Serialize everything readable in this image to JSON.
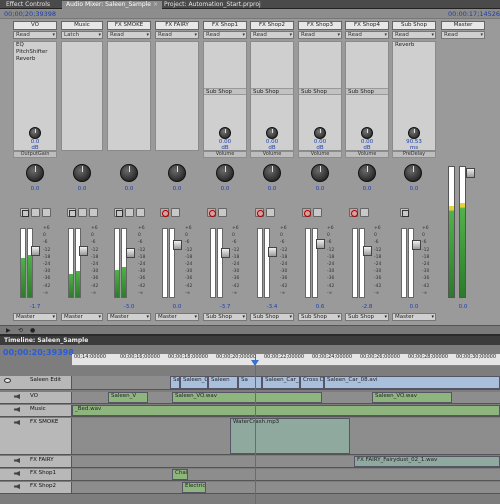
{
  "tabs": [
    {
      "label": "Effect Controls",
      "active": false
    },
    {
      "label": "Audio Mixer: Saleen_Sample",
      "active": true
    },
    {
      "label": "Project: Automation_Start.prproj",
      "active": false
    }
  ],
  "mixer": {
    "timecode_left": "00;00;20;39398",
    "timecode_right": "00:00:17;14526",
    "channels": [
      {
        "name": "VO",
        "mode": "Read",
        "effects": [
          "EQ",
          "PitchShifter",
          "Reverb"
        ],
        "knob_value": "0.0",
        "knob_unit": "dB",
        "param": "OutputGain",
        "pan": "0.0",
        "fader": "-1.7",
        "output": "Master"
      },
      {
        "name": "Music",
        "mode": "Latch",
        "effects": [],
        "pan": "0.0",
        "fader": "",
        "output": "Master"
      },
      {
        "name": "FX SMOKE",
        "mode": "Read",
        "effects": [],
        "pan": "0.0",
        "fader": "-3.0",
        "output": "Master"
      },
      {
        "name": "FX FAIRY",
        "mode": "Read",
        "effects": [],
        "pan": "0.0",
        "fader": "0.0",
        "output": "Master"
      },
      {
        "name": "FX Shop1",
        "mode": "Read",
        "effects": [],
        "send": "Sub Shop",
        "knob_value": "0.00",
        "knob_unit": "dB",
        "param": "Volume",
        "pan": "0.0",
        "fader": "-3.7",
        "output": "Sub Shop"
      },
      {
        "name": "FX Shop2",
        "mode": "Read",
        "effects": [],
        "send": "Sub Shop",
        "knob_value": "0.00",
        "knob_unit": "dB",
        "param": "Volume",
        "pan": "0.0",
        "fader": "-3.4",
        "output": "Sub Shop"
      },
      {
        "name": "FX Shop3",
        "mode": "Read",
        "effects": [],
        "send": "Sub Shop",
        "knob_value": "0.00",
        "knob_unit": "dB",
        "param": "Volume",
        "pan": "0.0",
        "fader": "0.6",
        "output": "Sub Shop"
      },
      {
        "name": "FX Shop4",
        "mode": "Read",
        "effects": [],
        "send": "Sub Shop",
        "knob_value": "0.00",
        "knob_unit": "dB",
        "param": "Volume",
        "pan": "0.0",
        "fader": "-2.8",
        "output": "Sub Shop"
      },
      {
        "name": "Sub Shop",
        "mode": "Read",
        "effects": [
          "Reverb"
        ],
        "knob_value": "90.53",
        "knob_unit": "ms",
        "param": "PreDelay",
        "pan": "0.0",
        "fader": "0.0",
        "output": "Master"
      },
      {
        "name": "Master",
        "mode": "Read",
        "effects": [],
        "fader": "0.0"
      }
    ],
    "scale": [
      "+6",
      "0",
      "-6",
      "-12",
      "-18",
      "-24",
      "-30",
      "-36",
      "-42",
      "-∞"
    ]
  },
  "timeline": {
    "title": "Timeline: Saleen_Sample",
    "timecode": "00;00:20;39398",
    "ruler": [
      "00;14:00000",
      "00;00;16;00000",
      "00;00;18;00000",
      "00;00;20;00000",
      "00;00;22;00000",
      "00;00;24;00000",
      "00;00;26;00000",
      "00;00;28;00000",
      "00;00;30;00000"
    ],
    "tracks": [
      {
        "name": "Saleen Edit",
        "clips": [
          "Sale",
          "Saleen_C",
          "Saleen",
          "Sa",
          "Saleen_Car_10",
          "Cross Di",
          "Saleen_Car_08.avi"
        ]
      },
      {
        "name": "VO",
        "clips": [
          "Saleen_V",
          "Saleen_VO.wav",
          "Saleen_VO.wav"
        ]
      },
      {
        "name": "Music",
        "clips": [
          "_Bed.wav"
        ]
      },
      {
        "name": "FX SMOKE",
        "clips": [
          "WaterCrash.mp3"
        ]
      },
      {
        "name": "FX FAIRY",
        "clips": [
          "FX FAIRY_Fairydust_02_1.wav"
        ]
      },
      {
        "name": "FX Shop1",
        "clips": [
          "Chain"
        ]
      },
      {
        "name": "FX Shop2",
        "clips": [
          "Electric"
        ]
      }
    ]
  }
}
